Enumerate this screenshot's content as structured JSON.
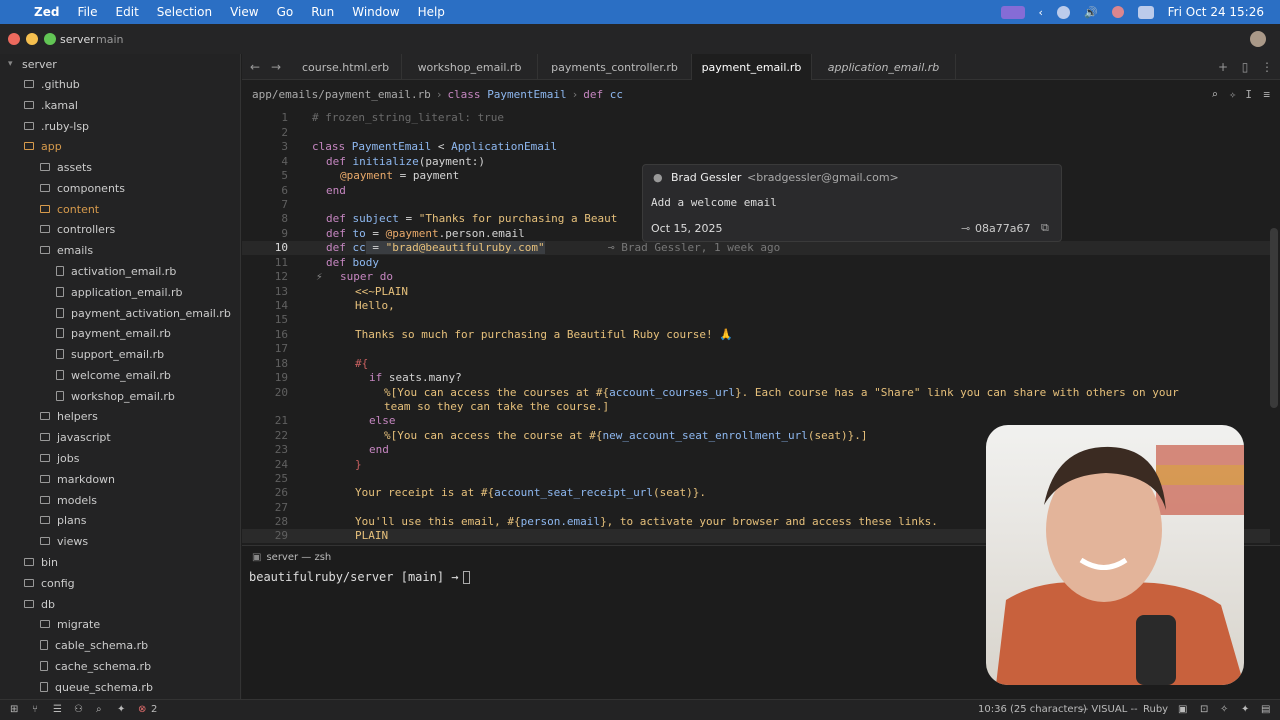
{
  "menubar": {
    "app": "Zed",
    "items": [
      "File",
      "Edit",
      "Selection",
      "View",
      "Go",
      "Run",
      "Window",
      "Help"
    ],
    "clock": "Fri Oct 24  15:26"
  },
  "titlebar": {
    "project": "server",
    "branch": "main"
  },
  "sidebar": {
    "items": [
      {
        "label": "server",
        "kind": "root"
      },
      {
        "label": ".github",
        "kind": "folder"
      },
      {
        "label": ".kamal",
        "kind": "folder"
      },
      {
        "label": ".ruby-lsp",
        "kind": "folder"
      },
      {
        "label": "app",
        "kind": "folder-open"
      },
      {
        "label": "assets",
        "kind": "folder"
      },
      {
        "label": "components",
        "kind": "folder"
      },
      {
        "label": "content",
        "kind": "folder"
      },
      {
        "label": "controllers",
        "kind": "folder"
      },
      {
        "label": "emails",
        "kind": "folder-open"
      },
      {
        "label": "activation_email.rb",
        "kind": "file"
      },
      {
        "label": "application_email.rb",
        "kind": "file"
      },
      {
        "label": "payment_activation_email.rb",
        "kind": "file"
      },
      {
        "label": "payment_email.rb",
        "kind": "file"
      },
      {
        "label": "support_email.rb",
        "kind": "file"
      },
      {
        "label": "welcome_email.rb",
        "kind": "file"
      },
      {
        "label": "workshop_email.rb",
        "kind": "file"
      },
      {
        "label": "helpers",
        "kind": "folder"
      },
      {
        "label": "javascript",
        "kind": "folder"
      },
      {
        "label": "jobs",
        "kind": "folder"
      },
      {
        "label": "markdown",
        "kind": "folder"
      },
      {
        "label": "models",
        "kind": "folder"
      },
      {
        "label": "plans",
        "kind": "folder"
      },
      {
        "label": "views",
        "kind": "folder"
      },
      {
        "label": "bin",
        "kind": "folder"
      },
      {
        "label": "config",
        "kind": "folder"
      },
      {
        "label": "db",
        "kind": "folder-open"
      },
      {
        "label": "migrate",
        "kind": "folder"
      },
      {
        "label": "cable_schema.rb",
        "kind": "file"
      },
      {
        "label": "cache_schema.rb",
        "kind": "file"
      },
      {
        "label": "queue_schema.rb",
        "kind": "file"
      }
    ]
  },
  "tabs": [
    "course.html.erb",
    "workshop_email.rb",
    "payments_controller.rb",
    "payment_email.rb",
    "application_email.rb"
  ],
  "breadcrumb": {
    "path": "app/emails/payment_email.rb",
    "kw1": "class",
    "cls": "PaymentEmail",
    "kw2": "def",
    "method": "cc"
  },
  "code": {
    "l1": "# frozen_string_literal: true",
    "l3a": "class",
    "l3b": "PaymentEmail",
    "l3c": " < ",
    "l3d": "ApplicationEmail",
    "l4a": "def",
    "l4b": "initialize",
    "l4c": "(payment:)",
    "l5a": "@payment",
    "l5b": " = payment",
    "l6": "end",
    "l8a": "def",
    "l8b": "subject",
    "l8c": " = ",
    "l8d": "\"Thanks for purchasing a Beaut",
    "l9a": "def",
    "l9b": "to",
    "l9c": " = ",
    "l9d": "@payment",
    "l9e": ".person.email",
    "l10a": "def",
    "l10b": "cc",
    "l10c": " = ",
    "l10d": "\"brad@beautifulruby.com\"",
    "l11a": "def",
    "l11b": "body",
    "l12": "super do",
    "l13": "<<~PLAIN",
    "l14": "Hello,",
    "l16": "Thanks so much for purchasing a Beautiful Ruby course! 🙏",
    "l18": "#{",
    "l19a": "if",
    "l19b": " seats.many?",
    "l20a": "%[You can access the courses at #{",
    "l20b": "account_courses_url",
    "l20c": "}. Each course has a \"Share\" link you can share with others on your",
    "l20d": "team so they can take the course.]",
    "l21": "else",
    "l22a": "%[You can access the course at #{",
    "l22b": "new_account_seat_enrollment_url",
    "l22c": "(seat)}.]",
    "l23": "end",
    "l24": "}",
    "l26a": "Your receipt is at #{",
    "l26b": "account_seat_receipt_url",
    "l26c": "(seat)}.",
    "l28a": "You'll use this email, #{",
    "l28b": "person.email",
    "l28c": "}, to activate your browser and access these links.",
    "l29": "PLAIN"
  },
  "line_numbers": [
    "1",
    "2",
    "3",
    "4",
    "5",
    "6",
    "7",
    "8",
    "9",
    "10",
    "11",
    "12",
    "13",
    "14",
    "15",
    "16",
    "17",
    "18",
    "19",
    "20",
    "21",
    "22",
    "23",
    "24",
    "25",
    "26",
    "27",
    "28",
    "29"
  ],
  "hover": {
    "author": "Brad Gessler",
    "email": "<bradgessler@gmail.com>",
    "message": "Add a welcome email",
    "date": "Oct 15, 2025",
    "sha": "08a77a67"
  },
  "blame": "Brad Gessler, 1 week ago",
  "terminal": {
    "tab": "server — zsh",
    "prompt": "beautifulruby/server [main] →"
  },
  "statusbar": {
    "diagnostics": "2",
    "position": "10:36 (25 characters)",
    "mode": "-- VISUAL --",
    "language": "Ruby"
  }
}
